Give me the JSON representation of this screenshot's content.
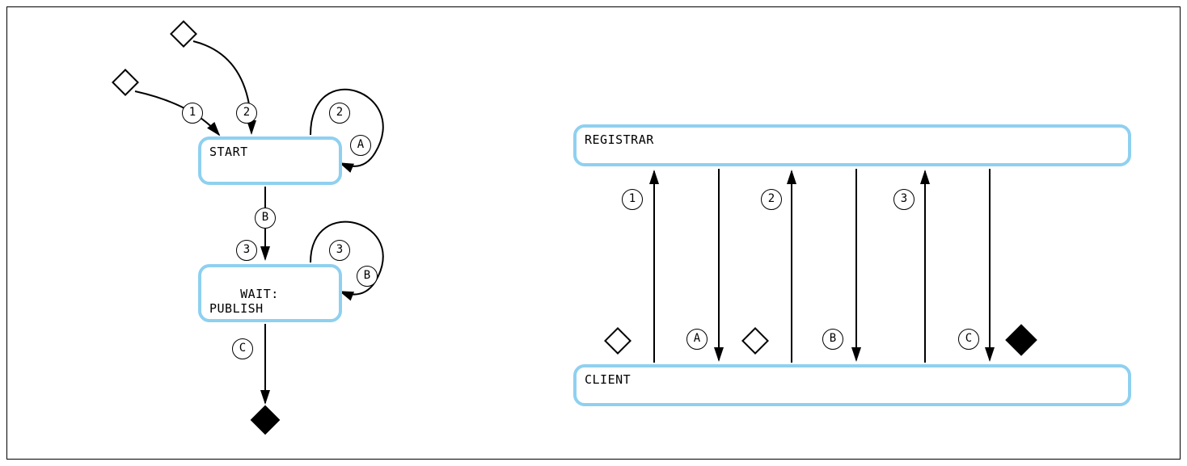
{
  "state_machine": {
    "nodes": {
      "start": "START",
      "wait_publish": "WAIT:\nPUBLISH"
    },
    "edge_labels": {
      "l1": "1",
      "l2a": "2",
      "l2b": "2",
      "lA": "A",
      "lB": "B",
      "l3a": "3",
      "l3b": "3",
      "lBself": "B",
      "lC": "C"
    }
  },
  "sequence": {
    "top_box": "REGISTRAR",
    "bottom_box": "CLIENT",
    "labels": {
      "s1": "1",
      "sA": "A",
      "s2": "2",
      "sB": "B",
      "s3": "3",
      "sC": "C"
    }
  }
}
